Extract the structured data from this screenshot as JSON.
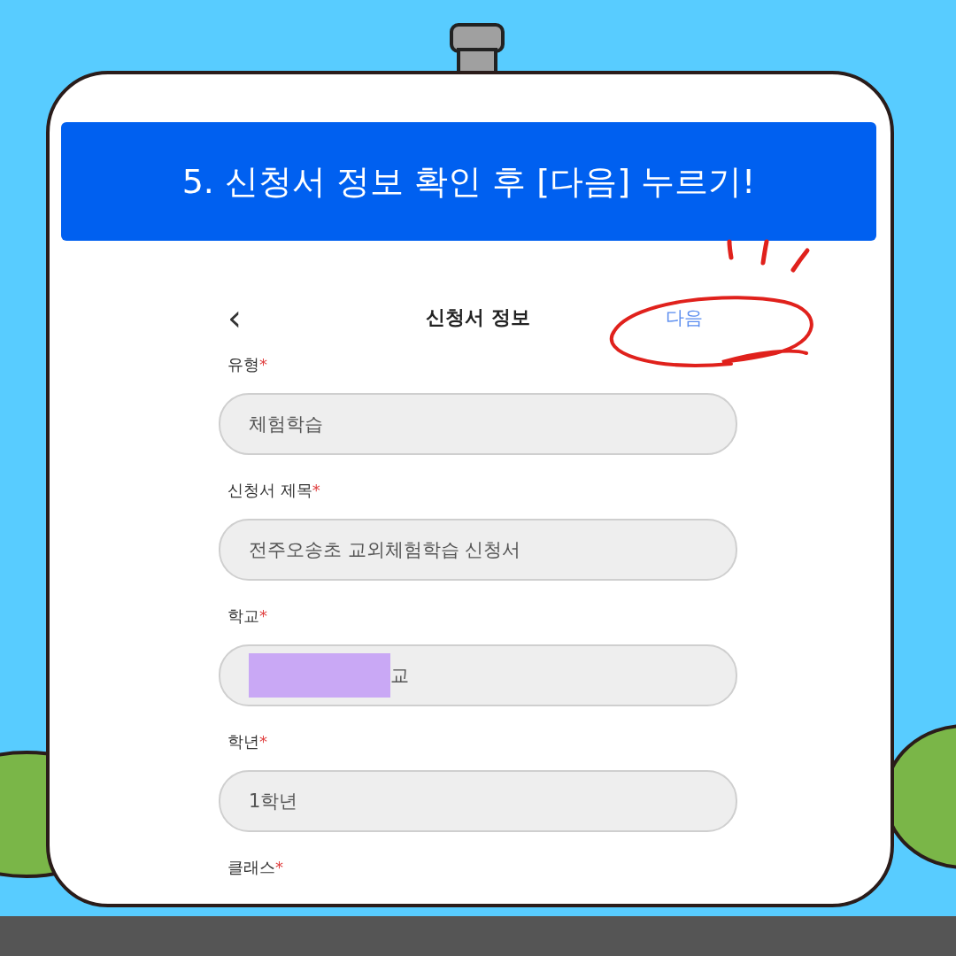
{
  "banner": {
    "title": "5. 신청서 정보 확인 후 [다음] 누르기!"
  },
  "app_header": {
    "back": "‹",
    "title": "신청서 정보",
    "next": "다음",
    "next_highlighted": true
  },
  "fields": [
    {
      "label": "유형",
      "mark": "*",
      "value": "체험학습"
    },
    {
      "label": "신청서 제목",
      "mark": "*",
      "value": "전주오송초 교외체험학습 신청서"
    },
    {
      "label": "학교",
      "mark": "*",
      "value": "교",
      "redacted": true
    },
    {
      "label": "학년",
      "mark": "*",
      "value": "1학년"
    },
    {
      "label": "클래스",
      "mark": "*"
    }
  ]
}
